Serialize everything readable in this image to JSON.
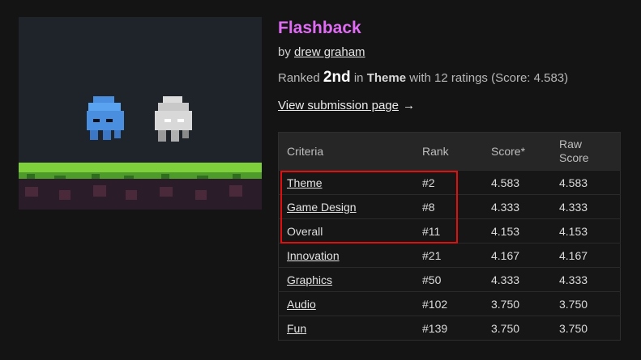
{
  "game": {
    "title": "Flashback",
    "by_prefix": "by",
    "author": "drew graham",
    "ranked_prefix": "Ranked",
    "place": "2nd",
    "in_word": "in",
    "criteria": "Theme",
    "ratings_text": "with 12 ratings (Score: 4.583)",
    "view_link": "View submission page",
    "arrow": "→"
  },
  "table": {
    "headers": {
      "criteria": "Criteria",
      "rank": "Rank",
      "score": "Score*",
      "raw_score": "Raw Score"
    },
    "rows": [
      {
        "criteria": "Theme",
        "rank": "#2",
        "score": "4.583",
        "raw": "4.583",
        "linked": true
      },
      {
        "criteria": "Game Design",
        "rank": "#8",
        "score": "4.333",
        "raw": "4.333",
        "linked": true
      },
      {
        "criteria": "Overall",
        "rank": "#11",
        "score": "4.153",
        "raw": "4.153",
        "linked": false
      },
      {
        "criteria": "Innovation",
        "rank": "#21",
        "score": "4.167",
        "raw": "4.167",
        "linked": true
      },
      {
        "criteria": "Graphics",
        "rank": "#50",
        "score": "4.333",
        "raw": "4.333",
        "linked": true
      },
      {
        "criteria": "Audio",
        "rank": "#102",
        "score": "3.750",
        "raw": "3.750",
        "linked": true
      },
      {
        "criteria": "Fun",
        "rank": "#139",
        "score": "3.750",
        "raw": "3.750",
        "linked": true
      }
    ]
  },
  "colors": {
    "title": "#e06cf5",
    "highlight": "#e01010",
    "background": "#141414"
  }
}
